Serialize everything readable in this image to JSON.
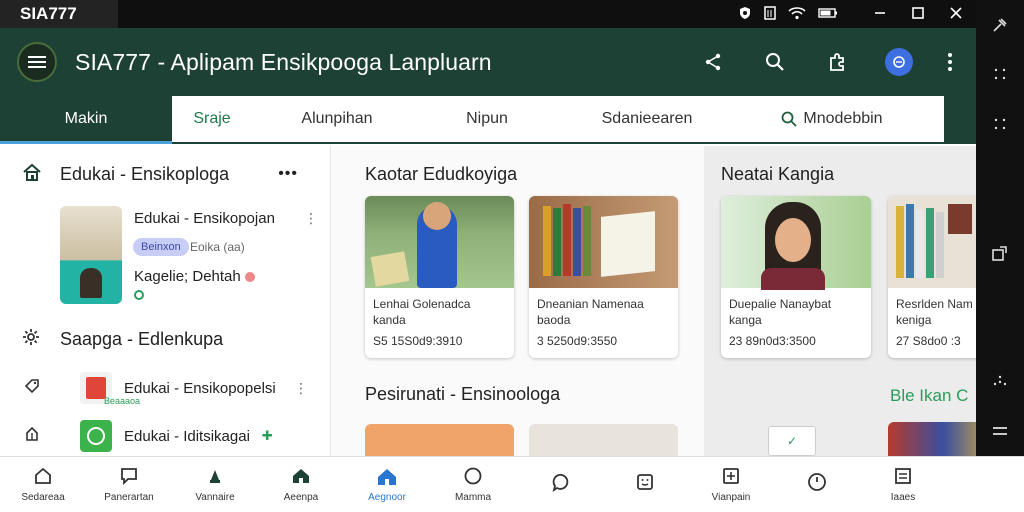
{
  "statusbar": {
    "brand": "SIA777",
    "icons": [
      "shield-icon",
      "sim-icon",
      "wifi-icon",
      "battery-icon"
    ],
    "window_controls": [
      "minimize-icon",
      "maximize-icon",
      "close-icon"
    ]
  },
  "appbar": {
    "title": "SIA777 - Aplipam Ensikpooga Lanpluarn",
    "actions": [
      "share-icon",
      "search-icon",
      "puzzle-icon",
      "avatar",
      "more-icon"
    ]
  },
  "tabs": {
    "main": "Makin",
    "items": [
      "Sraje",
      "Alunpihan",
      "Nipun",
      "Sdanieearen"
    ],
    "search_label": "Mnodebbin"
  },
  "sidebar": {
    "header": "Edukai - Ensikoploga",
    "feature": {
      "title": "Edukai - Ensikopojan",
      "chip": "Beinxon",
      "chip2": "Eoika (aa)",
      "author": "Kagelie; Dehtah"
    },
    "section2": "Saapga - Edlenkupa",
    "items": [
      {
        "label": "Edukai - Ensikopopelsi",
        "sub": "Beaaaoa"
      },
      {
        "label": "Edukai - Iditsikagai"
      }
    ]
  },
  "content": {
    "section1": "Kaotar Edudkoyiga",
    "cards": [
      {
        "caption": "Lenhai Golenadca kanda",
        "num": "S5 15S0d9:3910"
      },
      {
        "caption": "Dneanian Namenaa baoda",
        "num": "3 5250d9:3550"
      }
    ],
    "section2": "Pesirunati - Ensinoologa"
  },
  "right": {
    "title": "Neatai Kangia",
    "cards": [
      {
        "caption": "Duepalie Nanaybat kanga",
        "num": "23 89n0d3:3500"
      },
      {
        "caption": "Resrlden Nam keniga",
        "num": "27 S8do0 :3"
      }
    ],
    "link": "Ble Ikan C"
  },
  "bottomnav": [
    {
      "label": "Sedareaa",
      "icon": "home-icon"
    },
    {
      "label": "Panerartan",
      "icon": "chat-icon"
    },
    {
      "label": "Vannaire",
      "icon": "compass-icon"
    },
    {
      "label": "Aeenpa",
      "icon": "house-filled-icon"
    },
    {
      "label": "Aegnoor",
      "icon": "home-active-icon",
      "active": true
    },
    {
      "label": "Mamma",
      "icon": "circle-icon"
    },
    {
      "label": "",
      "icon": "bubble-icon"
    },
    {
      "label": "",
      "icon": "smile-icon"
    },
    {
      "label": "Vianpain",
      "icon": "add-box-icon"
    },
    {
      "label": "",
      "icon": "clock-icon"
    },
    {
      "label": "Iaaes",
      "icon": "list-icon"
    }
  ],
  "colors": {
    "primary": "#1e4136",
    "accent": "#2a75d0",
    "green": "#2a9d5a"
  }
}
